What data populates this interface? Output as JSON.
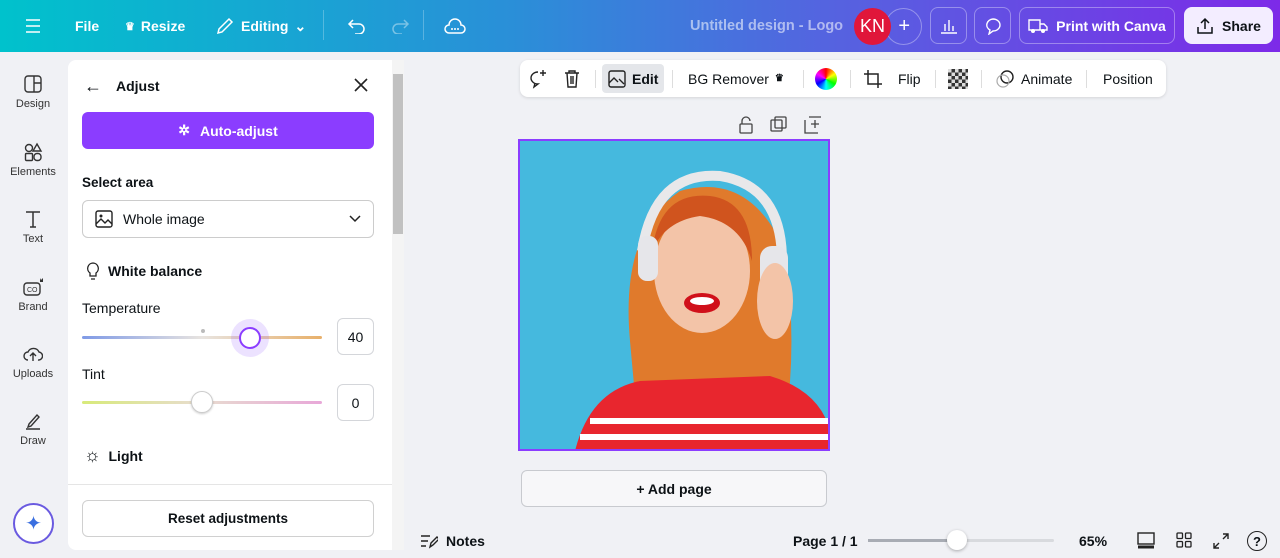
{
  "topbar": {
    "file": "File",
    "resize": "Resize",
    "editing": "Editing",
    "title": "Untitled design - Logo",
    "avatar": "KN",
    "print": "Print with Canva",
    "share": "Share"
  },
  "rail": [
    {
      "label": "Design"
    },
    {
      "label": "Elements"
    },
    {
      "label": "Text"
    },
    {
      "label": "Brand"
    },
    {
      "label": "Uploads"
    },
    {
      "label": "Draw"
    }
  ],
  "panel": {
    "title": "Adjust",
    "auto_adjust": "Auto-adjust",
    "select_area_label": "Select area",
    "select_area_value": "Whole image",
    "white_balance": "White balance",
    "temperature_label": "Temperature",
    "temperature_value": "40",
    "tint_label": "Tint",
    "tint_value": "0",
    "light": "Light",
    "reset": "Reset adjustments"
  },
  "sliders": {
    "temperature": 40,
    "tint": 0,
    "range": [
      -100,
      100
    ]
  },
  "toolbar": {
    "edit": "Edit",
    "bg_remover": "BG Remover",
    "flip": "Flip",
    "animate": "Animate",
    "position": "Position"
  },
  "canvas": {
    "add_page": "+ Add page"
  },
  "footer": {
    "notes": "Notes",
    "page": "Page 1 / 1",
    "zoom": "65%",
    "zoom_value": 65
  }
}
